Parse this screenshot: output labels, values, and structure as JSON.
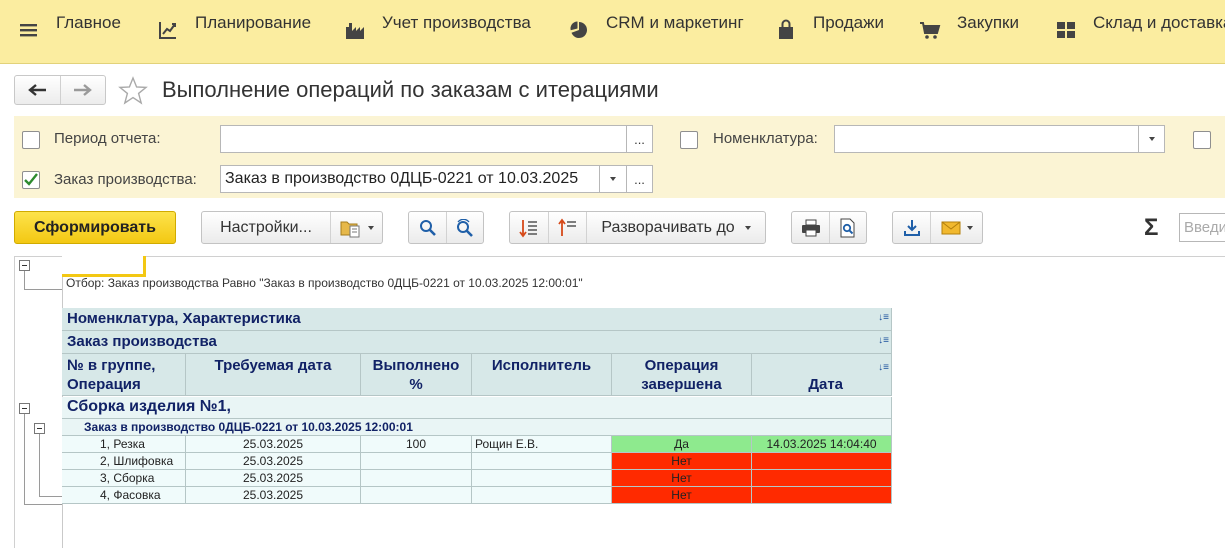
{
  "menu": {
    "items": [
      {
        "label": "Главное",
        "icon": "hamburger-icon"
      },
      {
        "label": "Планирование",
        "icon": "planning-icon"
      },
      {
        "label": "Учет производства",
        "icon": "factory-icon"
      },
      {
        "label": "CRM и маркетинг",
        "icon": "pie-chart-icon"
      },
      {
        "label": "Продажи",
        "icon": "shopping-bag-icon"
      },
      {
        "label": "Закупки",
        "icon": "cart-icon"
      },
      {
        "label": "Склад и доставка",
        "icon": "warehouse-icon"
      }
    ]
  },
  "title": "Выполнение операций по заказам с итерациями",
  "filters": {
    "period_label": "Период отчета:",
    "period_value": "",
    "period_btn": "...",
    "nomenclature_label": "Номенклатура:",
    "nomenclature_value": "",
    "order_label": "Заказ производства:",
    "order_value": "Заказ в производство 0ДЦБ-0221 от 10.03.2025",
    "order_btn": "..."
  },
  "toolbar": {
    "generate": "Сформировать",
    "settings": "Настройки...",
    "expand_to": "Разворачивать до",
    "search_placeholder": "Введи"
  },
  "report": {
    "filter_line": "Отбор:   Заказ производства Равно \"Заказ в производство 0ДЦБ-0221 от 10.03.2025 12:00:01\"",
    "header_row1": "Номенклатура, Характеристика",
    "header_row2": "Заказ производства",
    "columns": [
      "№ в группе,\nОперация",
      "Требуемая дата",
      "Выполнено\n%",
      "Исполнитель",
      "Операция\nзавершена",
      "Дата\nвыполнения"
    ],
    "group_title": "Сборка изделия №1,",
    "order_title": "Заказ в производство 0ДЦБ-0221 от 10.03.2025 12:00:01",
    "rows": [
      {
        "op": "1, Резка",
        "date": "25.03.2025",
        "done": "100",
        "executor": "Рощин Е.В.",
        "completed": "Да",
        "done_date": "14.03.2025 14:04:40",
        "status": "yes"
      },
      {
        "op": "2, Шлифовка",
        "date": "25.03.2025",
        "done": "",
        "executor": "",
        "completed": "Нет",
        "done_date": "",
        "status": "no"
      },
      {
        "op": "3, Сборка",
        "date": "25.03.2025",
        "done": "",
        "executor": "",
        "completed": "Нет",
        "done_date": "",
        "status": "no"
      },
      {
        "op": "4, Фасовка",
        "date": "25.03.2025",
        "done": "",
        "executor": "",
        "completed": "Нет",
        "done_date": "",
        "status": "no"
      }
    ]
  },
  "colors": {
    "menu_bg": "#fbeda0",
    "filter_bg": "#fbf4d4",
    "header_bg": "#d7e8e8",
    "row_bg": "#f0fbfb",
    "yes_bg": "#8eea8e",
    "no_bg": "#ff2a00",
    "accent": "#f3c813"
  }
}
